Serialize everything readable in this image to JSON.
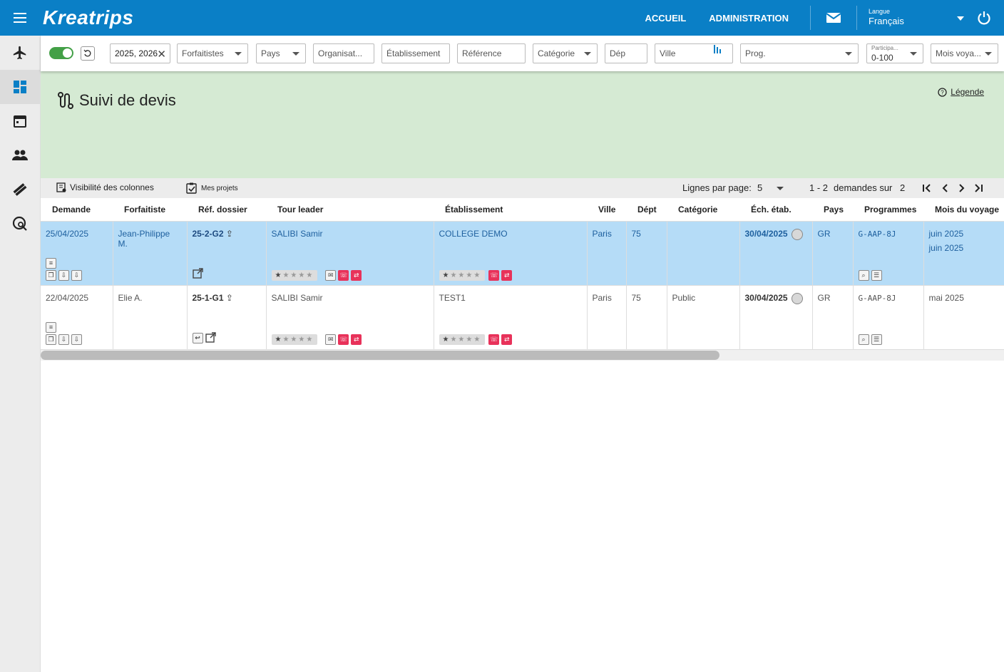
{
  "app": {
    "logo": "Kreatrips"
  },
  "topbar": {
    "nav": [
      "ACCUEIL",
      "ADMINISTRATION"
    ],
    "language_label": "Langue",
    "language_value": "Français"
  },
  "filters": {
    "year": "2025, 2026",
    "forfaitistes": "Forfaitistes",
    "pays": "Pays",
    "organisateur": "Organisat...",
    "etablissement": "Établissement",
    "reference": "Référence",
    "categorie": "Catégorie",
    "dep": "Dép",
    "ville": "Ville",
    "prog": "Prog.",
    "participants_label": "Participa...",
    "participants_value": "0-100",
    "mois": "Mois voya..."
  },
  "page": {
    "title": "Suivi de devis",
    "legend_link": "Légende"
  },
  "toolbar": {
    "columns_visibility": "Visibilité des colonnes",
    "my_projects": "Mes projets",
    "rows_per_page_label": "Lignes par page:",
    "rows_per_page_value": "5",
    "range": "1 - 2",
    "total_label": "demandes sur",
    "total_value": "2"
  },
  "table": {
    "headers": [
      "Demande",
      "Forfaitiste",
      "Réf. dossier",
      "Tour leader",
      "Établissement",
      "Ville",
      "Dépt",
      "Catégorie",
      "Éch. étab.",
      "Pays",
      "Programmes",
      "Mois du voyage"
    ],
    "rows": [
      {
        "demande": "25/04/2025",
        "forfaitiste": "Jean-Philippe M.",
        "ref": "25-2-G2",
        "tour_leader": "SALIBI Samir",
        "etablissement": "COLLEGE DEMO",
        "ville": "Paris",
        "dept": "75",
        "categorie": "",
        "echeance": "30/04/2025",
        "pays": "GR",
        "programme": "G-AAP-8J",
        "mois1": "juin 2025",
        "mois2": "juin 2025"
      },
      {
        "demande": "22/04/2025",
        "forfaitiste": "Elie A.",
        "ref": "25-1-G1",
        "tour_leader": "SALIBI Samir",
        "etablissement": "TEST1",
        "ville": "Paris",
        "dept": "75",
        "categorie": "Public",
        "echeance": "30/04/2025",
        "pays": "GR",
        "programme": "G-AAP-8J",
        "mois1": "mai 2025",
        "mois2": ""
      }
    ]
  },
  "colors": {
    "brand": "#0a7fc6",
    "header_band": "#d5ead3",
    "selected_row": "#b5dcf7",
    "alert": "#e8325a",
    "toggle": "#43a047"
  }
}
